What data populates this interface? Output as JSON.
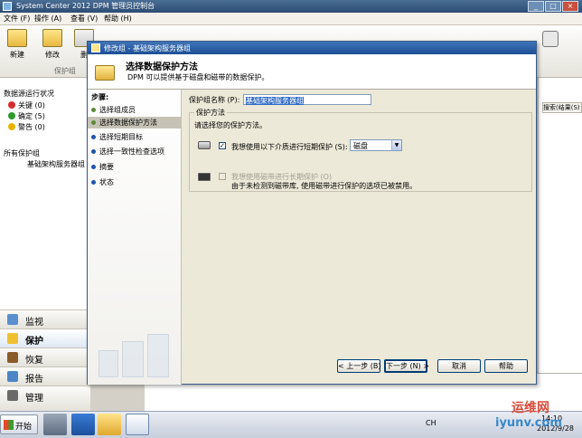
{
  "window": {
    "title": "System Center 2012 DPM 管理员控制台"
  },
  "menu": [
    "文件 (F)",
    "操作 (A)",
    "查看 (V)",
    "帮助 (H)"
  ],
  "toolbar": {
    "buttons": [
      {
        "label": "新建",
        "icon": "new-group-icon"
      },
      {
        "label": "修改",
        "icon": "modify-group-icon"
      },
      {
        "label": "删",
        "icon": "delete-group-icon"
      }
    ],
    "group_label": "保护组"
  },
  "left_pane": {
    "status_heading": "数据源运行状况",
    "status_items": [
      {
        "label": "关键 (0)",
        "color": "#d32f2f"
      },
      {
        "label": "确定 (5)",
        "color": "#2e9a2e"
      },
      {
        "label": "警告 (0)",
        "color": "#e8b400"
      }
    ],
    "groups_heading": "所有保护组",
    "group_item": "基础架构服务器组",
    "nav": [
      "监视",
      "保护",
      "恢复",
      "报告",
      "管理"
    ],
    "nav_selected": 1
  },
  "right_pane": {
    "search_label": "搜索(结果(S)"
  },
  "dialog": {
    "title": "修改组 - 基础架构服务器组",
    "heading": "选择数据保护方法",
    "subheading": "DPM 可以提供基于磁盘和磁带的数据保护。",
    "steps_heading": "步骤:",
    "steps": [
      "选择组成员",
      "选择数据保护方法",
      "选择短期目标",
      "选择一致性检查选项",
      "摘要",
      "状态"
    ],
    "current_step": 1,
    "pg_name_label": "保护组名称 (P):",
    "pg_name_value": "基础架构服务器组",
    "group_title": "保护方法",
    "group_desc": "请选择您的保护方法。",
    "option1_label": "我想使用以下介质进行短期保护 (S):",
    "option1_checked": true,
    "option1_media": "磁盘",
    "option2_label": "我想使用磁带进行长期保护 (O)",
    "option2_checked": false,
    "option2_note": "由于未检测到磁带库, 使用磁带进行保护的选项已被禁用。",
    "buttons": {
      "back": "< 上一步 (B)",
      "next": "下一步 (N) >",
      "cancel": "取消",
      "help": "帮助"
    }
  },
  "taskbar": {
    "start": "开始",
    "lang": "CH",
    "time": "14:10",
    "date": "2012/9/28"
  },
  "watermark": {
    "line1": "运维网",
    "line2": "iyunv.com"
  }
}
